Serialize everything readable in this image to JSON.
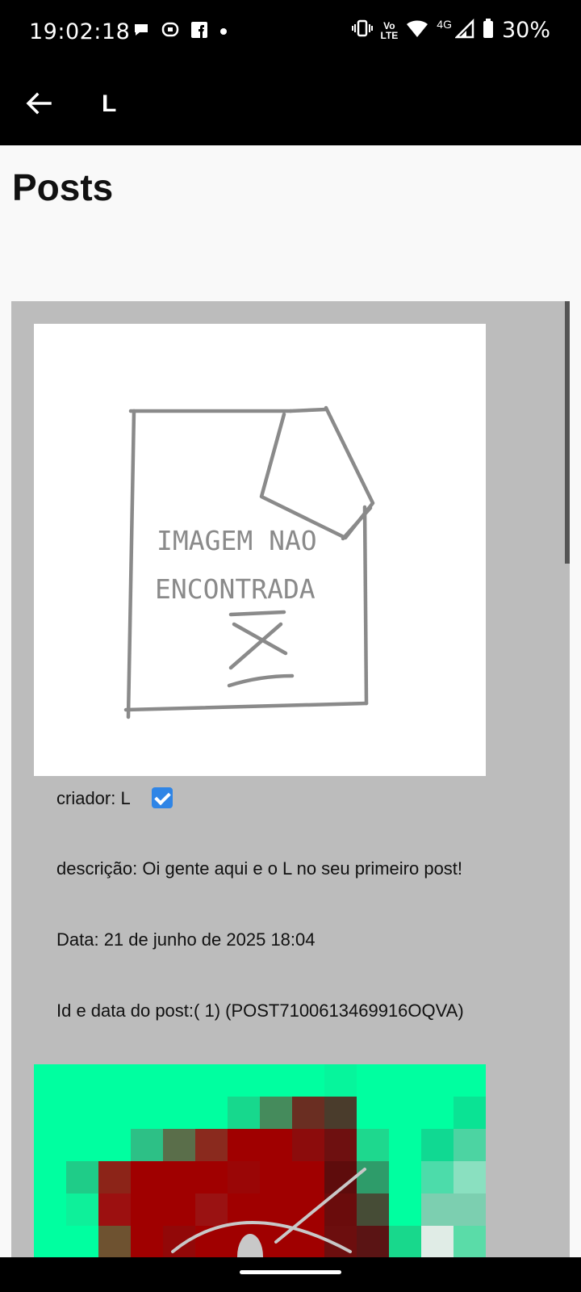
{
  "status_bar": {
    "time": "19:02:18",
    "battery_percent": "30%",
    "network_4g": "4G",
    "volte_label_top": "Vo",
    "volte_label_bottom": "LTE"
  },
  "app_bar": {
    "title": "L",
    "back_icon": "arrow-left-icon"
  },
  "page": {
    "title": "Posts"
  },
  "post": {
    "creator_line": "criador: L",
    "verified_icon": "check-box-icon",
    "description_line": "descrição: Oi gente aqui e o L no seu primeiro post!",
    "date_line": "Data: 21 de junho de 2025 18:04",
    "id_line": "Id e data do post:( 1) (POST7100613469916OQVA)",
    "placeholder_text_1": "IMAGEM NAO",
    "placeholder_text_2": "ENCONTRADA"
  },
  "colors": {
    "bars": "#000000",
    "panel": "#bcbcbc",
    "accent_green": "#00ffa0",
    "accent_red": "#a00000"
  }
}
